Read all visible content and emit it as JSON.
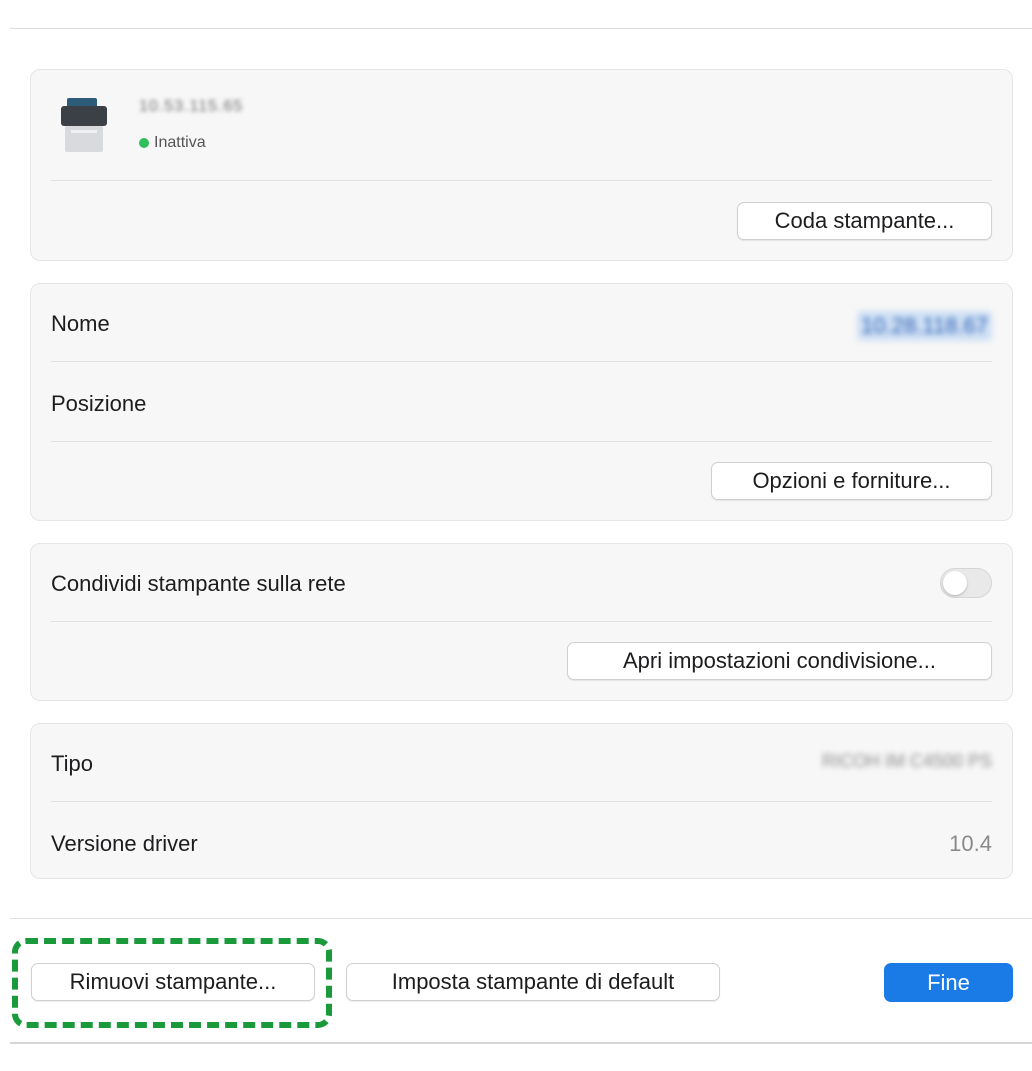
{
  "printer": {
    "name": "10.53.115.65",
    "status_text": "Inattiva",
    "status_color": "#2fbf5b",
    "icon": "printer-icon",
    "queue_button": "Coda stampante..."
  },
  "details": {
    "name_label": "Nome",
    "name_value": "10.28.118.67",
    "location_label": "Posizione",
    "location_value": "",
    "options_button": "Opzioni e forniture..."
  },
  "sharing": {
    "share_label": "Condividi stampante sulla rete",
    "share_enabled": false,
    "open_settings_button": "Apri impostazioni condivisione..."
  },
  "info": {
    "type_label": "Tipo",
    "type_value": "RICOH IM C4500 PS",
    "driver_label": "Versione driver",
    "driver_value": "10.4"
  },
  "footer": {
    "remove_button": "Rimuovi stampante...",
    "default_button": "Imposta stampante di default",
    "done_button": "Fine"
  },
  "colors": {
    "accent": "#1a7ae6",
    "highlight": "#1a9a3a"
  }
}
